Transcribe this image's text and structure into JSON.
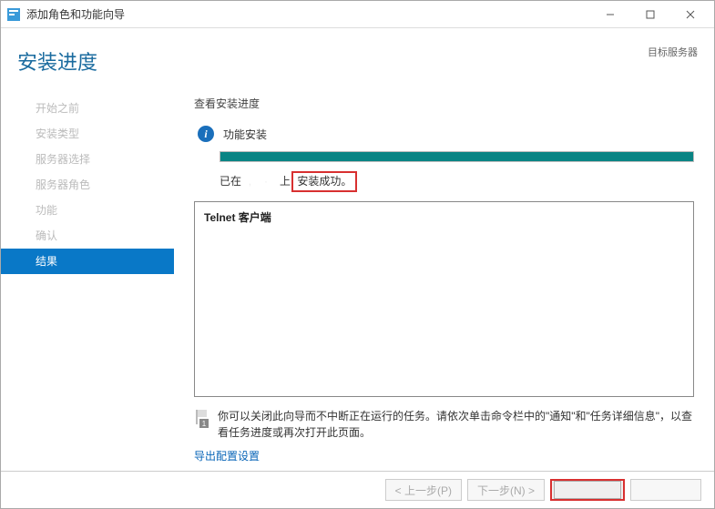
{
  "titlebar": {
    "title": "添加角色和功能向导"
  },
  "header": {
    "title": "安装进度",
    "target_label": "目标服务器"
  },
  "sidebar": {
    "items": [
      {
        "label": "开始之前"
      },
      {
        "label": "安装类型"
      },
      {
        "label": "服务器选择"
      },
      {
        "label": "服务器角色"
      },
      {
        "label": "功能"
      },
      {
        "label": "确认"
      },
      {
        "label": "结果"
      }
    ]
  },
  "main": {
    "progress_label": "查看安装进度",
    "status_label": "功能安装",
    "result_prefix": "已在",
    "result_middle": "上",
    "result_success": "安装成功。",
    "feature_title": "Telnet 客户端",
    "note_text": "你可以关闭此向导而不中断正在运行的任务。请依次单击命令栏中的\"通知\"和\"任务详细信息\"，以查看任务进度或再次打开此页面。",
    "export_link": "导出配置设置"
  },
  "footer": {
    "prev": "< 上一步(P)",
    "next": "下一步(N) >",
    "close": " ",
    "cancel": " "
  }
}
